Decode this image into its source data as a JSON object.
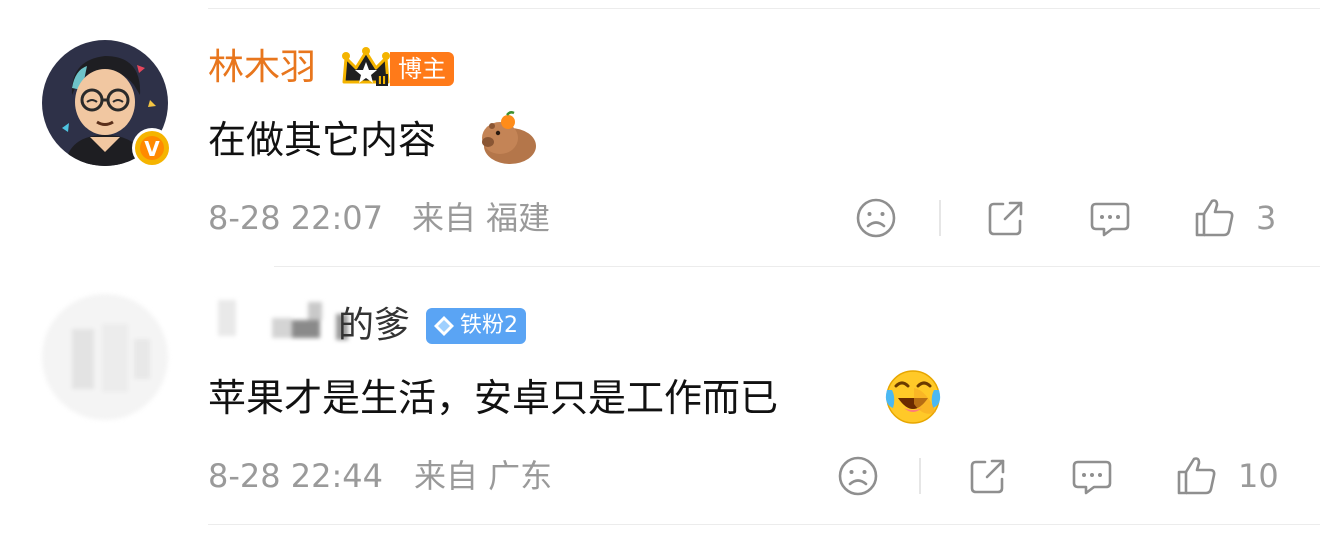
{
  "comments": [
    {
      "username": "林木羽",
      "username_color": "#e8761d",
      "badge_label": "博主",
      "text": "在做其它内容",
      "emoji_icon": "capybara-with-orange-icon",
      "date": "8-28 22:07",
      "source": "来自 福建",
      "likes": "3"
    },
    {
      "username": "的爹",
      "username_color": "#333333",
      "badge_label": "铁粉2",
      "text": "苹果才是生活，安卓只是工作而已",
      "emoji_icon": "laughing-tears-icon",
      "date": "8-28 22:44",
      "source": "来自 广东",
      "likes": "10"
    }
  ],
  "colors": {
    "meta": "#9a9a9a",
    "blogger_badge": "#ff7a19",
    "fan_badge": "#5aa4f4",
    "verified": "#f5b400"
  }
}
